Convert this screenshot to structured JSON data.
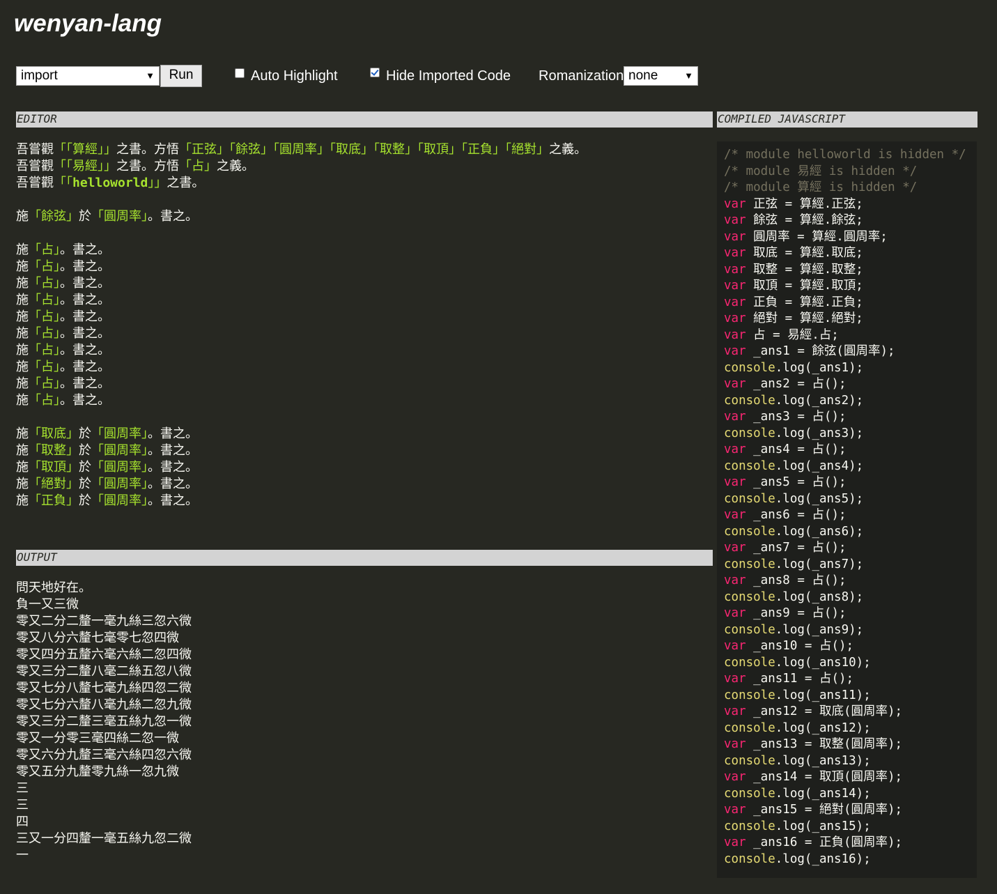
{
  "app": {
    "title": "wenyan-lang"
  },
  "toolbar": {
    "example_select": "import",
    "run_label": "Run",
    "auto_highlight_label": "Auto Highlight",
    "auto_highlight_checked": false,
    "hide_imported_label": "Hide Imported Code",
    "hide_imported_checked": true,
    "romanization_label": "Romanization",
    "romanization_select": "none"
  },
  "editor": {
    "header": "EDITOR",
    "lines": [
      [
        {
          "t": "吾嘗觀"
        },
        {
          "t": "「「算經」」",
          "g": 1
        },
        {
          "t": "之書。方悟"
        },
        {
          "t": "「正弦」",
          "g": 1
        },
        {
          "t": "「餘弦」",
          "g": 1
        },
        {
          "t": "「圓周率」",
          "g": 1
        },
        {
          "t": "「取底」",
          "g": 1
        },
        {
          "t": "「取整」",
          "g": 1
        },
        {
          "t": "「取頂」",
          "g": 1
        },
        {
          "t": "「正負」",
          "g": 1
        },
        {
          "t": "「絕對」",
          "g": 1
        },
        {
          "t": "之義。"
        }
      ],
      [
        {
          "t": "吾嘗觀"
        },
        {
          "t": "「「易經」」",
          "g": 1
        },
        {
          "t": "之書。方悟"
        },
        {
          "t": "「占」",
          "g": 1
        },
        {
          "t": "之義。"
        }
      ],
      [
        {
          "t": "吾嘗觀"
        },
        {
          "t": "「「",
          "g": 1
        },
        {
          "t": "helloworld",
          "g": 2
        },
        {
          "t": "」」",
          "g": 1
        },
        {
          "t": "之書。"
        }
      ],
      [],
      [
        {
          "t": "施"
        },
        {
          "t": "「餘弦」",
          "g": 1
        },
        {
          "t": "於"
        },
        {
          "t": "「圓周率」",
          "g": 1
        },
        {
          "t": "。書之。"
        }
      ],
      [],
      [
        {
          "t": "施"
        },
        {
          "t": "「占」",
          "g": 1
        },
        {
          "t": "。書之。"
        }
      ],
      [
        {
          "t": "施"
        },
        {
          "t": "「占」",
          "g": 1
        },
        {
          "t": "。書之。"
        }
      ],
      [
        {
          "t": "施"
        },
        {
          "t": "「占」",
          "g": 1
        },
        {
          "t": "。書之。"
        }
      ],
      [
        {
          "t": "施"
        },
        {
          "t": "「占」",
          "g": 1
        },
        {
          "t": "。書之。"
        }
      ],
      [
        {
          "t": "施"
        },
        {
          "t": "「占」",
          "g": 1
        },
        {
          "t": "。書之。"
        }
      ],
      [
        {
          "t": "施"
        },
        {
          "t": "「占」",
          "g": 1
        },
        {
          "t": "。書之。"
        }
      ],
      [
        {
          "t": "施"
        },
        {
          "t": "「占」",
          "g": 1
        },
        {
          "t": "。書之。"
        }
      ],
      [
        {
          "t": "施"
        },
        {
          "t": "「占」",
          "g": 1
        },
        {
          "t": "。書之。"
        }
      ],
      [
        {
          "t": "施"
        },
        {
          "t": "「占」",
          "g": 1
        },
        {
          "t": "。書之。"
        }
      ],
      [
        {
          "t": "施"
        },
        {
          "t": "「占」",
          "g": 1
        },
        {
          "t": "。書之。"
        }
      ],
      [],
      [
        {
          "t": "施"
        },
        {
          "t": "「取底」",
          "g": 1
        },
        {
          "t": "於"
        },
        {
          "t": "「圓周率」",
          "g": 1
        },
        {
          "t": "。書之。"
        }
      ],
      [
        {
          "t": "施"
        },
        {
          "t": "「取整」",
          "g": 1
        },
        {
          "t": "於"
        },
        {
          "t": "「圓周率」",
          "g": 1
        },
        {
          "t": "。書之。"
        }
      ],
      [
        {
          "t": "施"
        },
        {
          "t": "「取頂」",
          "g": 1
        },
        {
          "t": "於"
        },
        {
          "t": "「圓周率」",
          "g": 1
        },
        {
          "t": "。書之。"
        }
      ],
      [
        {
          "t": "施"
        },
        {
          "t": "「絕對」",
          "g": 1
        },
        {
          "t": "於"
        },
        {
          "t": "「圓周率」",
          "g": 1
        },
        {
          "t": "。書之。"
        }
      ],
      [
        {
          "t": "施"
        },
        {
          "t": "「正負」",
          "g": 1
        },
        {
          "t": "於"
        },
        {
          "t": "「圓周率」",
          "g": 1
        },
        {
          "t": "。書之。"
        }
      ]
    ]
  },
  "output": {
    "header": "OUTPUT",
    "lines": [
      "問天地好在。",
      "負一又三微",
      "零又二分二釐一毫九絲三忽六微",
      "零又八分六釐七毫零七忽四微",
      "零又四分五釐六毫六絲二忽四微",
      "零又三分二釐八毫二絲五忽八微",
      "零又七分八釐七毫九絲四忽二微",
      "零又七分六釐八毫九絲二忽九微",
      "零又三分二釐三毫五絲九忽一微",
      "零又一分零三毫四絲二忽一微",
      "零又六分九釐三毫六絲四忽六微",
      "零又五分九釐零九絲一忽九微",
      "三",
      "三",
      "四",
      "三又一分四釐一毫五絲九忽二微",
      "一"
    ]
  },
  "compiled": {
    "header": "COMPILED JAVASCRIPT",
    "lines": [
      [
        {
          "t": "/* module helloworld is hidden */",
          "c": "c"
        }
      ],
      [
        {
          "t": "/* module 易經 is hidden */",
          "c": "c"
        }
      ],
      [
        {
          "t": "/* module 算經 is hidden */",
          "c": "c"
        }
      ],
      [
        {
          "t": "var",
          "c": "k"
        },
        {
          "t": " 正弦 = 算經.正弦;"
        }
      ],
      [
        {
          "t": "var",
          "c": "k"
        },
        {
          "t": " 餘弦 = 算經.餘弦;"
        }
      ],
      [
        {
          "t": "var",
          "c": "k"
        },
        {
          "t": " 圓周率 = 算經.圓周率;"
        }
      ],
      [
        {
          "t": "var",
          "c": "k"
        },
        {
          "t": " 取底 = 算經.取底;"
        }
      ],
      [
        {
          "t": "var",
          "c": "k"
        },
        {
          "t": " 取整 = 算經.取整;"
        }
      ],
      [
        {
          "t": "var",
          "c": "k"
        },
        {
          "t": " 取頂 = 算經.取頂;"
        }
      ],
      [
        {
          "t": "var",
          "c": "k"
        },
        {
          "t": " 正負 = 算經.正負;"
        }
      ],
      [
        {
          "t": "var",
          "c": "k"
        },
        {
          "t": " 絕對 = 算經.絕對;"
        }
      ],
      [
        {
          "t": "var",
          "c": "k"
        },
        {
          "t": " 占 = 易經.占;"
        }
      ],
      [
        {
          "t": "var",
          "c": "k"
        },
        {
          "t": " _ans1 = 餘弦(圓周率);"
        }
      ],
      [
        {
          "t": "console",
          "c": "y"
        },
        {
          "t": ".log(_ans1);"
        }
      ],
      [
        {
          "t": "var",
          "c": "k"
        },
        {
          "t": " _ans2 = 占();"
        }
      ],
      [
        {
          "t": "console",
          "c": "y"
        },
        {
          "t": ".log(_ans2);"
        }
      ],
      [
        {
          "t": "var",
          "c": "k"
        },
        {
          "t": " _ans3 = 占();"
        }
      ],
      [
        {
          "t": "console",
          "c": "y"
        },
        {
          "t": ".log(_ans3);"
        }
      ],
      [
        {
          "t": "var",
          "c": "k"
        },
        {
          "t": " _ans4 = 占();"
        }
      ],
      [
        {
          "t": "console",
          "c": "y"
        },
        {
          "t": ".log(_ans4);"
        }
      ],
      [
        {
          "t": "var",
          "c": "k"
        },
        {
          "t": " _ans5 = 占();"
        }
      ],
      [
        {
          "t": "console",
          "c": "y"
        },
        {
          "t": ".log(_ans5);"
        }
      ],
      [
        {
          "t": "var",
          "c": "k"
        },
        {
          "t": " _ans6 = 占();"
        }
      ],
      [
        {
          "t": "console",
          "c": "y"
        },
        {
          "t": ".log(_ans6);"
        }
      ],
      [
        {
          "t": "var",
          "c": "k"
        },
        {
          "t": " _ans7 = 占();"
        }
      ],
      [
        {
          "t": "console",
          "c": "y"
        },
        {
          "t": ".log(_ans7);"
        }
      ],
      [
        {
          "t": "var",
          "c": "k"
        },
        {
          "t": " _ans8 = 占();"
        }
      ],
      [
        {
          "t": "console",
          "c": "y"
        },
        {
          "t": ".log(_ans8);"
        }
      ],
      [
        {
          "t": "var",
          "c": "k"
        },
        {
          "t": " _ans9 = 占();"
        }
      ],
      [
        {
          "t": "console",
          "c": "y"
        },
        {
          "t": ".log(_ans9);"
        }
      ],
      [
        {
          "t": "var",
          "c": "k"
        },
        {
          "t": " _ans10 = 占();"
        }
      ],
      [
        {
          "t": "console",
          "c": "y"
        },
        {
          "t": ".log(_ans10);"
        }
      ],
      [
        {
          "t": "var",
          "c": "k"
        },
        {
          "t": " _ans11 = 占();"
        }
      ],
      [
        {
          "t": "console",
          "c": "y"
        },
        {
          "t": ".log(_ans11);"
        }
      ],
      [
        {
          "t": "var",
          "c": "k"
        },
        {
          "t": " _ans12 = 取底(圓周率);"
        }
      ],
      [
        {
          "t": "console",
          "c": "y"
        },
        {
          "t": ".log(_ans12);"
        }
      ],
      [
        {
          "t": "var",
          "c": "k"
        },
        {
          "t": " _ans13 = 取整(圓周率);"
        }
      ],
      [
        {
          "t": "console",
          "c": "y"
        },
        {
          "t": ".log(_ans13);"
        }
      ],
      [
        {
          "t": "var",
          "c": "k"
        },
        {
          "t": " _ans14 = 取頂(圓周率);"
        }
      ],
      [
        {
          "t": "console",
          "c": "y"
        },
        {
          "t": ".log(_ans14);"
        }
      ],
      [
        {
          "t": "var",
          "c": "k"
        },
        {
          "t": " _ans15 = 絕對(圓周率);"
        }
      ],
      [
        {
          "t": "console",
          "c": "y"
        },
        {
          "t": ".log(_ans15);"
        }
      ],
      [
        {
          "t": "var",
          "c": "k"
        },
        {
          "t": " _ans16 = 正負(圓周率);"
        }
      ],
      [
        {
          "t": "console",
          "c": "y"
        },
        {
          "t": ".log(_ans16);"
        }
      ]
    ]
  }
}
